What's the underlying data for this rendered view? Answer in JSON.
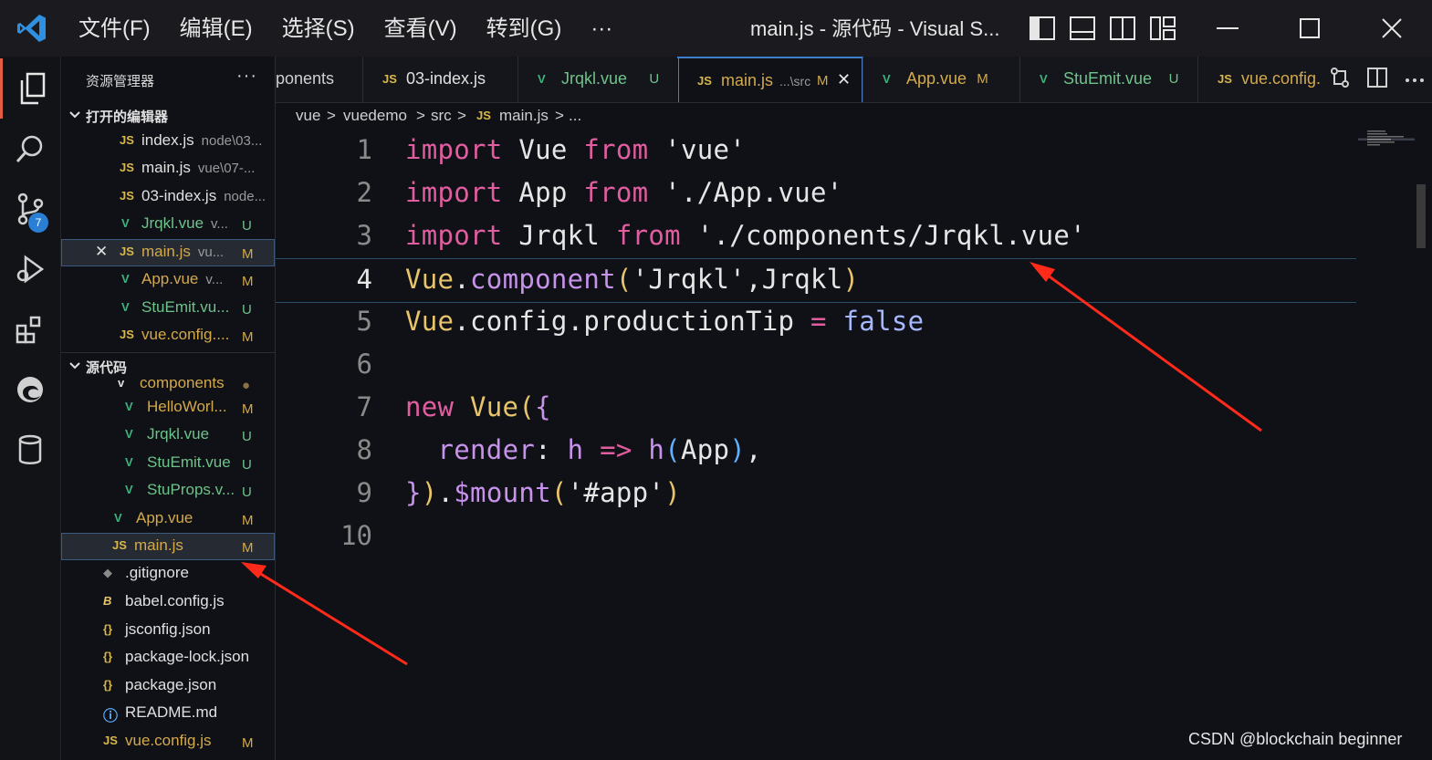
{
  "titlebar": {
    "menus": [
      "文件(F)",
      "编辑(E)",
      "选择(S)",
      "查看(V)",
      "转到(G)",
      "···"
    ],
    "window_title": "main.js - 源代码 - Visual S..."
  },
  "activity": {
    "source_control_badge": "7"
  },
  "sidebar": {
    "title": "资源管理器",
    "more": "···",
    "open_editors_label": "打开的编辑器",
    "open_editors": [
      {
        "icon": "JS",
        "name": "index.js",
        "desc": "node\\03...",
        "status": ""
      },
      {
        "icon": "JS",
        "name": "main.js",
        "desc": "vue\\07-...",
        "status": ""
      },
      {
        "icon": "JS",
        "name": "03-index.js",
        "desc": "node...",
        "status": ""
      },
      {
        "icon": "V",
        "name": "Jrqkl.vue",
        "desc": "v...",
        "status": "U"
      },
      {
        "icon": "JS",
        "name": "main.js",
        "desc": "vu...",
        "status": "M"
      },
      {
        "icon": "V",
        "name": "App.vue",
        "desc": "v...",
        "status": "M"
      },
      {
        "icon": "V",
        "name": "StuEmit.vu...",
        "desc": "",
        "status": "U"
      },
      {
        "icon": "JS",
        "name": "vue.config....",
        "desc": "",
        "status": "M"
      }
    ],
    "source_label": "源代码",
    "tree": [
      {
        "icon": "v",
        "name": "components",
        "status": "●"
      },
      {
        "icon": "V",
        "name": "HelloWorl...",
        "status": "M"
      },
      {
        "icon": "V",
        "name": "Jrqkl.vue",
        "status": "U"
      },
      {
        "icon": "V",
        "name": "StuEmit.vue",
        "status": "U"
      },
      {
        "icon": "V",
        "name": "StuProps.v...",
        "status": "U"
      },
      {
        "icon": "V",
        "name": "App.vue",
        "status": "M"
      },
      {
        "icon": "JS",
        "name": "main.js",
        "status": "M"
      },
      {
        "icon": "◆",
        "name": ".gitignore",
        "status": ""
      },
      {
        "icon": "B",
        "name": "babel.config.js",
        "status": ""
      },
      {
        "icon": "{}",
        "name": "jsconfig.json",
        "status": ""
      },
      {
        "icon": "{}",
        "name": "package-lock.json",
        "status": ""
      },
      {
        "icon": "{}",
        "name": "package.json",
        "status": ""
      },
      {
        "icon": "ⓘ",
        "name": "README.md",
        "status": ""
      },
      {
        "icon": "JS",
        "name": "vue.config.js",
        "status": "M"
      }
    ]
  },
  "tabs": [
    {
      "icon": "",
      "name": "ponents",
      "extra": "",
      "status": ""
    },
    {
      "icon": "JS",
      "name": "03-index.js",
      "extra": "",
      "status": ""
    },
    {
      "icon": "V",
      "name": "Jrqkl.vue",
      "extra": "",
      "status": "U"
    },
    {
      "icon": "JS",
      "name": "main.js",
      "extra": "...\\src",
      "status": "M"
    },
    {
      "icon": "V",
      "name": "App.vue",
      "extra": "",
      "status": "M"
    },
    {
      "icon": "V",
      "name": "StuEmit.vue",
      "extra": "",
      "status": "U"
    },
    {
      "icon": "JS",
      "name": "vue.config.",
      "extra": "",
      "status": ""
    }
  ],
  "tab_close": "✕",
  "breadcrumb": [
    "vue",
    ">",
    "vuedemo",
    ">",
    "src",
    ">",
    "JS",
    "main.js",
    ">",
    "..."
  ],
  "editor": {
    "line_numbers": [
      "1",
      "2",
      "3",
      "4",
      "5",
      "6",
      "7",
      "8",
      "9",
      "10"
    ],
    "lines": [
      [
        [
          "kw",
          "import"
        ],
        [
          "id",
          " Vue "
        ],
        [
          "kw",
          "from"
        ],
        [
          "str",
          " 'vue'"
        ]
      ],
      [
        [
          "kw",
          "import"
        ],
        [
          "id",
          " App "
        ],
        [
          "kw",
          "from"
        ],
        [
          "str",
          " './App.vue'"
        ]
      ],
      [
        [
          "kw",
          "import"
        ],
        [
          "id",
          " Jrqkl "
        ],
        [
          "kw",
          "from"
        ],
        [
          "str",
          " './components/Jrqkl.vue'"
        ]
      ],
      [
        [
          "cls",
          "Vue"
        ],
        [
          "pn",
          "."
        ],
        [
          "fn",
          "component"
        ],
        [
          "br1",
          "("
        ],
        [
          "str",
          "'Jrqkl'"
        ],
        [
          "pn",
          ",Jrqkl"
        ],
        [
          "br1",
          ")"
        ]
      ],
      [
        [
          "cls",
          "Vue"
        ],
        [
          "pn",
          "."
        ],
        [
          "id",
          "config"
        ],
        [
          "pn",
          "."
        ],
        [
          "id",
          "productionTip"
        ],
        [
          "kw",
          " ="
        ],
        [
          "bool",
          " false"
        ]
      ],
      [],
      [
        [
          "kw",
          "new"
        ],
        [
          "cls",
          " Vue"
        ],
        [
          "br1",
          "("
        ],
        [
          "br2",
          "{"
        ]
      ],
      [
        [
          "id",
          "  "
        ],
        [
          "fn",
          "render"
        ],
        [
          "pn",
          ": "
        ],
        [
          "fn",
          "h"
        ],
        [
          "kw",
          " =>"
        ],
        [
          "fn",
          " h"
        ],
        [
          "br3",
          "("
        ],
        [
          "id",
          "App"
        ],
        [
          "br3",
          ")"
        ],
        [
          "pn",
          ","
        ]
      ],
      [
        [
          "br2",
          "}"
        ],
        [
          "br1",
          ")"
        ],
        [
          "pn",
          "."
        ],
        [
          "fn",
          "$mount"
        ],
        [
          "br1",
          "("
        ],
        [
          "str",
          "'#app'"
        ],
        [
          "br1",
          ")"
        ]
      ],
      []
    ]
  },
  "watermark": "CSDN @blockchain beginner"
}
